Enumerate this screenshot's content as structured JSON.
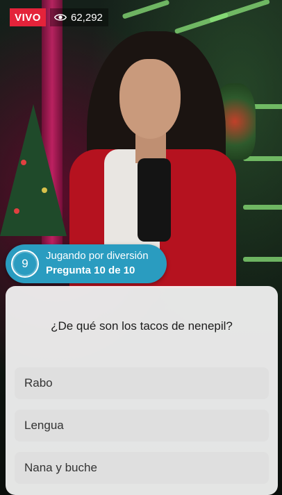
{
  "stream": {
    "live_label": "VIVO",
    "viewer_count": "62,292",
    "viewer_icon": "eye-icon"
  },
  "game": {
    "round_number": "9",
    "mode_label": "Jugando por diversión",
    "progress_label": "Pregunta 10 de 10"
  },
  "quiz": {
    "question": "¿De qué son los tacos de nenepil?",
    "answers": [
      "Rabo",
      "Lengua",
      "Nana y buche"
    ]
  },
  "colors": {
    "live_red": "#e4233a",
    "status_blue": "#2a9cc0",
    "card_bg": "#f7f7f7",
    "answer_bg": "#dedede"
  }
}
